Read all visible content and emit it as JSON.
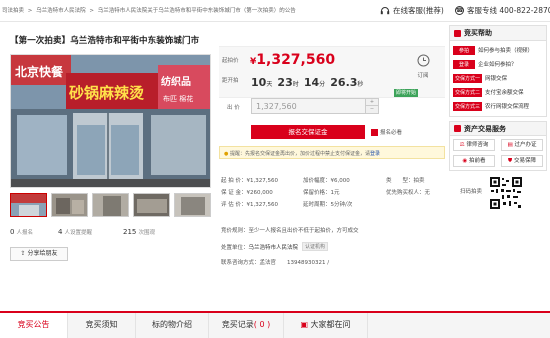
{
  "breadcrumb": [
    "司法拍卖",
    ">",
    "乌兰浩特市人民法院",
    ">",
    "乌兰浩特市人民法院关于乌兰浩特市和平街中东装饰城门市（第一次拍卖）的公告"
  ],
  "header": {
    "service_online": "在线客服(推荐)",
    "service_phone": "客服专线 400-822-2870"
  },
  "title": "【第一次拍卖】乌兰浩特市和平街中东装饰城门市",
  "photo_signs": {
    "main": "砂锅麻辣烫",
    "left": "北京快餐",
    "right1": "纺织品",
    "right2": "布匹 棉花"
  },
  "stats": {
    "registered": "0",
    "registered_label": "人报名",
    "reminders": "4",
    "reminders_label": "人设置提醒",
    "views": "215",
    "views_label": "次围观",
    "share": "分享给朋友"
  },
  "price": {
    "start_label": "起拍价",
    "start_value": "1,327,560",
    "currency": "¥",
    "countdown_label": "距开拍",
    "countdown": {
      "days": "10",
      "d_unit": "天",
      "hours": "23",
      "h_unit": "时",
      "minutes": "14",
      "m_unit": "分",
      "seconds": "26.3",
      "s_unit": "秒"
    },
    "remind": "订阅",
    "badge": "即将开始"
  },
  "bid": {
    "label": "出 价",
    "placeholder": "1,327,560"
  },
  "register": {
    "button": "报名交保证金",
    "enroll_required": "报名必看"
  },
  "notice": {
    "text": "提醒：先报名交保证金再出价，加价过程中禁止支付保证金，请",
    "login": "登录"
  },
  "params": {
    "col1": [
      {
        "k": "起 拍 价：",
        "v": "¥1,327,560"
      },
      {
        "k": "保 证 金：",
        "v": "¥260,000"
      },
      {
        "k": "评 估 价：",
        "v": "¥1,327,560"
      }
    ],
    "col2": [
      {
        "k": "加价幅度：",
        "v": "¥6,000"
      },
      {
        "k": "保留价格：",
        "v": "1元"
      },
      {
        "k": "延时周期：",
        "v": "5分钟/次"
      }
    ],
    "col3": [
      {
        "k": "类　　型：",
        "v": "拍卖"
      },
      {
        "k": "优先购买权人：",
        "v": "无"
      }
    ]
  },
  "rules": {
    "row1": "竞价规则：至少一人报名且出价不低于起拍价，方可成交",
    "unit_label": "处置单位：",
    "unit_value": "乌兰浩特市人民法院",
    "unit_badge": "认证机构",
    "contact": "联系咨询方式：孟法官　　13948930321 /"
  },
  "scan": "扫码拍卖",
  "sidebar": {
    "help_title": "竞买帮助",
    "help": [
      {
        "tag": "参拍",
        "text": "如何参与拍卖（视频）"
      },
      {
        "tag": "登录",
        "text": "企业如何参拍？"
      },
      {
        "tag": "交保方式一",
        "text": "网银交保"
      },
      {
        "tag": "交保方式二",
        "text": "支付宝余额交保"
      },
      {
        "tag": "交保方式三",
        "text": "农行网银交保流程"
      }
    ],
    "service_title": "资产交易服务",
    "services": [
      "律师咨询",
      "过户办证",
      "拍前看",
      "交易保障"
    ]
  },
  "tabs": [
    "竞买公告",
    "竞买须知",
    "标的物介绍",
    "竞买记录",
    "( 0 )",
    "大家都在问"
  ],
  "colors": {
    "accent": "#d9001b",
    "link": "#1f4fa8",
    "badge_green": "#3da35a"
  }
}
